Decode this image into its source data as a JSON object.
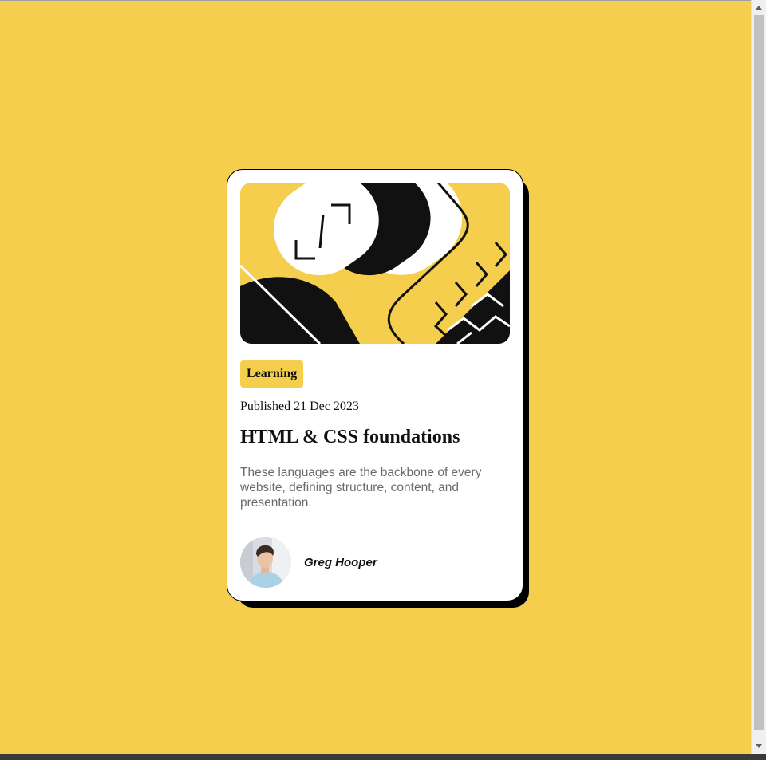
{
  "card": {
    "tag": "Learning",
    "published": "Published 21 Dec 2023",
    "title": "HTML & CSS foundations",
    "description": "These languages are the backbone of every website, defining structure, content, and presentation.",
    "author": "Greg Hooper",
    "hero_icon": "abstract-illustration",
    "avatar_icon": "author-avatar"
  },
  "colors": {
    "background": "#f4ce4c",
    "card": "#ffffff",
    "accent": "#f4ce4c",
    "text": "#111111",
    "muted": "#6b6b6b",
    "shadow": "#000000"
  }
}
